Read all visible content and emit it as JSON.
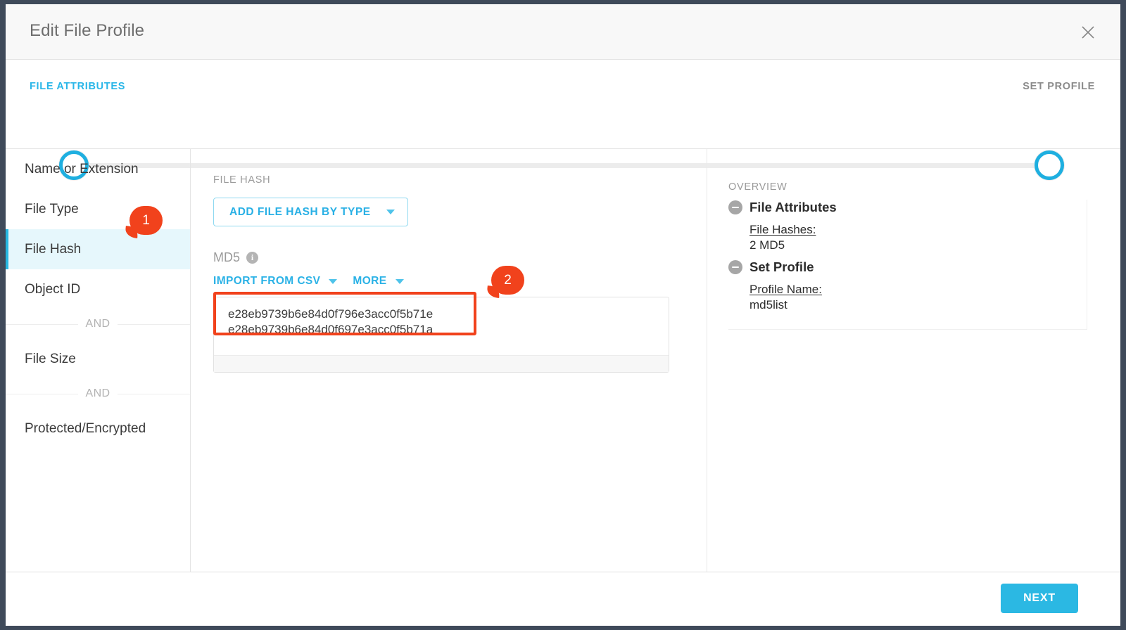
{
  "window": {
    "title": "Edit File Profile",
    "close_icon": "close-icon"
  },
  "stepper": {
    "steps": [
      {
        "label": "FILE ATTRIBUTES",
        "state": "active"
      },
      {
        "label": "SET PROFILE",
        "state": "upcoming"
      }
    ],
    "active_color": "#29b6e8",
    "inactive_color": "#8b8b8b"
  },
  "sidebar": {
    "items": [
      {
        "label": "Name or Extension",
        "active": false
      },
      {
        "label": "File Type",
        "active": false
      },
      {
        "label": "File Hash",
        "active": true
      },
      {
        "label": "Object ID",
        "active": false
      },
      {
        "label": "File Size",
        "active": false
      },
      {
        "label": "Protected/Encrypted",
        "active": false
      }
    ],
    "separators": [
      "AND",
      "AND"
    ],
    "active_accent": "#27b7e0",
    "active_background": "#e6f7fc"
  },
  "main": {
    "section_label": "FILE HASH",
    "add_hash_button": "ADD FILE HASH BY TYPE",
    "hash_type": "MD5",
    "info_icon_char": "i",
    "import_button": "IMPORT FROM CSV",
    "more_button": "MORE",
    "hashes": [
      "e28eb9739b6e84d0f796e3acc0f5b71e",
      "e28eb9739b6e84d0f697e3acc0f5b71a"
    ],
    "hash_text": "e28eb9739b6e84d0f796e3acc0f5b71e\ne28eb9739b6e84d0f697e3acc0f5b71a"
  },
  "overview": {
    "label": "OVERVIEW",
    "groups": [
      {
        "title": "File Attributes",
        "fields": [
          {
            "key": "File Hashes:",
            "value": "2 MD5"
          }
        ]
      },
      {
        "title": "Set Profile",
        "fields": [
          {
            "key": "Profile Name:",
            "value": "md5list"
          }
        ]
      }
    ]
  },
  "footer": {
    "next_button": "NEXT",
    "next_color": "#2bb8e3"
  },
  "annotations": {
    "markers": [
      {
        "number": "1",
        "target": "sidebar-item-file-hash"
      },
      {
        "number": "2",
        "target": "hash-textarea"
      }
    ],
    "highlight_color": "#f1421c"
  }
}
